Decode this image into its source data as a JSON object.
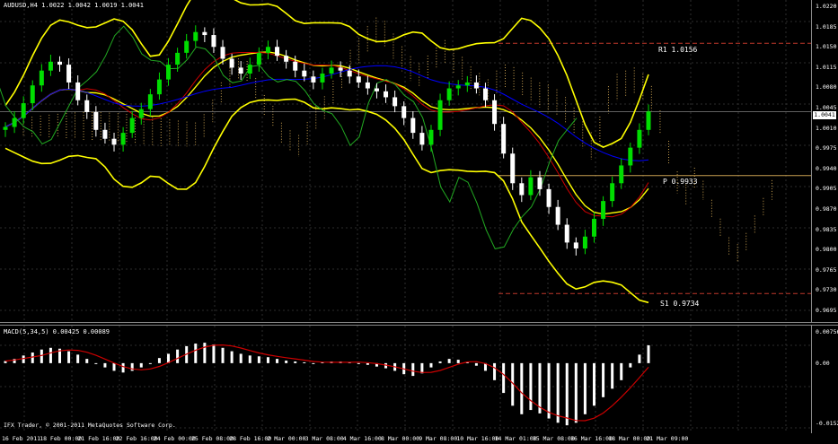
{
  "chart_header": "AUDUSD,H4  1.0022 1.0042 1.0019 1.0041",
  "macd_header": "MACD(5,34,5) 0.00425 0.00089",
  "copyright": "IFX Trader, © 2001-2011 MetaQuotes Software Corp.",
  "current_price": "1.0041",
  "pivots": {
    "r1": {
      "label": "R1  1.0156",
      "value": 1.0156,
      "color": "#c0392b"
    },
    "p": {
      "label": "P  0.9933",
      "value": 0.9933,
      "color": "#c8a050"
    },
    "s1": {
      "label": "S1  0.9734",
      "value": 0.9734,
      "color": "#c0392b"
    }
  },
  "price_ticks": [
    "1.0220",
    "1.0185",
    "1.0150",
    "1.0115",
    "1.0080",
    "1.0045",
    "1.0010",
    "0.9975",
    "0.9940",
    "0.9905",
    "0.9870",
    "0.9835",
    "0.9800",
    "0.9765",
    "0.9730",
    "0.9695"
  ],
  "macd_ticks": [
    "0.00756",
    "0.00",
    "-0.0152"
  ],
  "time_ticks": [
    "16 Feb 2011",
    "18 Feb 00:00",
    "21 Feb 16:00",
    "22 Feb 16:00",
    "24 Feb 00:00",
    "25 Feb 08:00",
    "28 Feb 16:00",
    "2 Mar 00:00",
    "3 Mar 08:00",
    "4 Mar 16:00",
    "8 Mar 00:00",
    "9 Mar 08:00",
    "10 Mar 16:00",
    "14 Mar 01:00",
    "15 Mar 08:00",
    "16 Mar 16:00",
    "18 Mar 00:00",
    "21 Mar 09:00"
  ],
  "colors": {
    "background": "#000000",
    "grid": "#3a3a3a",
    "bull_candle": "#00dd00",
    "bear_candle": "#ffffff",
    "bollinger": "#ffff00",
    "chikou": "#22aa22",
    "tenkan": "#cc0000",
    "kijun": "#0000ff",
    "cloud": "#c8a050",
    "macd_hist": "#ffffff",
    "macd_signal": "#cc0000"
  },
  "chart_data": {
    "type": "candlestick",
    "price_range": [
      0.9695,
      1.022
    ],
    "closes": [
      1.0015,
      1.003,
      1.0055,
      1.0085,
      1.011,
      1.0125,
      1.012,
      1.009,
      1.006,
      1.004,
      1.001,
      0.9995,
      0.9985,
      1.0005,
      1.003,
      1.0045,
      1.007,
      1.0095,
      1.012,
      1.014,
      1.016,
      1.0175,
      1.017,
      1.015,
      1.013,
      1.0115,
      1.0105,
      1.012,
      1.014,
      1.015,
      1.0135,
      1.0125,
      1.011,
      1.01,
      1.009,
      1.0105,
      1.0115,
      1.011,
      1.01,
      1.009,
      1.008,
      1.0075,
      1.0065,
      1.005,
      1.003,
      1.0005,
      0.9985,
      1.001,
      1.006,
      1.008,
      1.0085,
      1.009,
      1.008,
      1.006,
      1.002,
      0.997,
      0.992,
      0.99,
      0.993,
      0.991,
      0.988,
      0.985,
      0.982,
      0.981,
      0.983,
      0.986,
      0.989,
      0.992,
      0.995,
      0.998,
      1.001,
      1.0041
    ],
    "macd_hist": [
      0.0005,
      0.001,
      0.0018,
      0.0025,
      0.0032,
      0.0036,
      0.0034,
      0.0028,
      0.002,
      0.001,
      0.0,
      -0.001,
      -0.0018,
      -0.0022,
      -0.0018,
      -0.001,
      0.0,
      0.0012,
      0.0022,
      0.0032,
      0.004,
      0.0046,
      0.0048,
      0.0044,
      0.0036,
      0.0028,
      0.0022,
      0.0018,
      0.0016,
      0.0014,
      0.001,
      0.0006,
      0.0004,
      0.0002,
      -0.0002,
      0.0002,
      0.0004,
      0.0004,
      0.0002,
      0.0,
      -0.0004,
      -0.0008,
      -0.0012,
      -0.0018,
      -0.0026,
      -0.003,
      -0.0024,
      -0.001,
      0.0004,
      0.001,
      0.0008,
      0.0002,
      -0.0006,
      -0.0018,
      -0.004,
      -0.007,
      -0.01,
      -0.012,
      -0.011,
      -0.0118,
      -0.013,
      -0.014,
      -0.0146,
      -0.014,
      -0.012,
      -0.01,
      -0.008,
      -0.006,
      -0.004,
      -0.001,
      0.002,
      0.0042
    ]
  }
}
